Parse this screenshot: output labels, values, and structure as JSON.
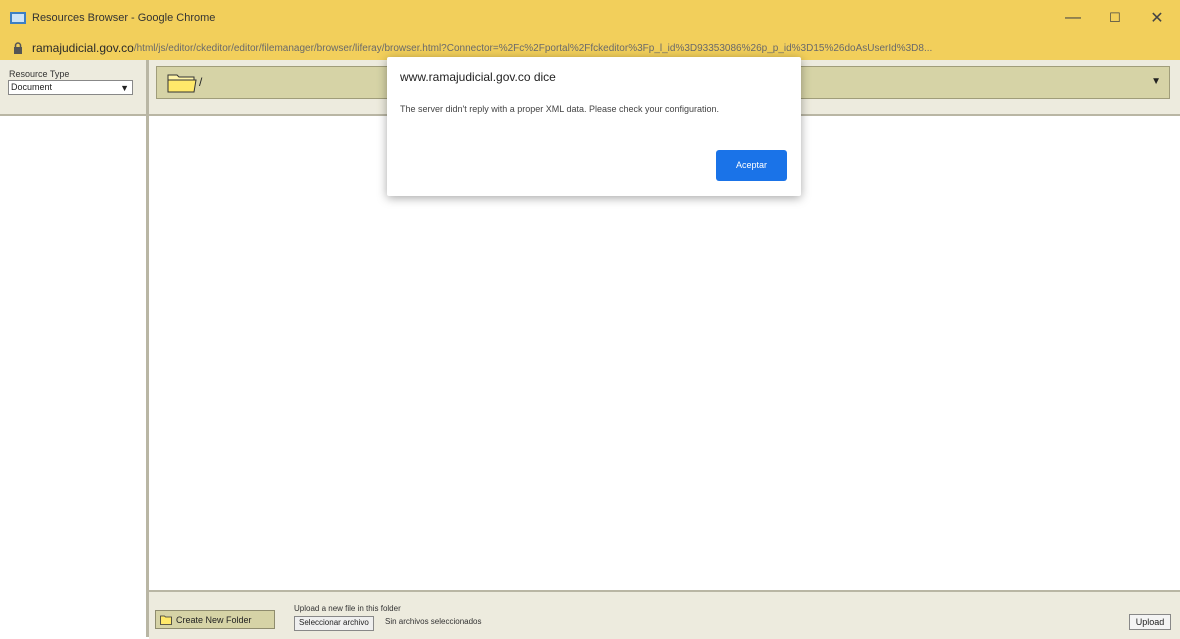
{
  "window": {
    "title": "Resources Browser - Google Chrome",
    "minimize": "—",
    "maximize": "☐",
    "close": "✕"
  },
  "address": {
    "host": "ramajudicial.gov.co",
    "path": "/html/js/editor/ckeditor/editor/filemanager/browser/liferay/browser.html?Connector=%2Fc%2Fportal%2Ffckeditor%3Fp_l_id%3D93353086%26p_p_id%3D15%26doAsUserId%3D8..."
  },
  "sidebar": {
    "resource_type_label": "Resource Type",
    "resource_type_value": "Document"
  },
  "main": {
    "current_path": "/"
  },
  "bottom": {
    "create_folder_label": "Create New Folder",
    "upload_label": "Upload a new file in this folder",
    "choose_file_label": "Seleccionar archivo",
    "no_file_text": "Sin archivos seleccionados",
    "upload_button": "Upload"
  },
  "dialog": {
    "title": "www.ramajudicial.gov.co dice",
    "message": "The server didn't reply with a proper XML data. Please check your configuration.",
    "ok_label": "Aceptar"
  },
  "colors": {
    "titlebar": "#f2cf5b",
    "panel": "#edebde",
    "folder_bar": "#d6d3a6",
    "dialog_button": "#1a73e8"
  }
}
